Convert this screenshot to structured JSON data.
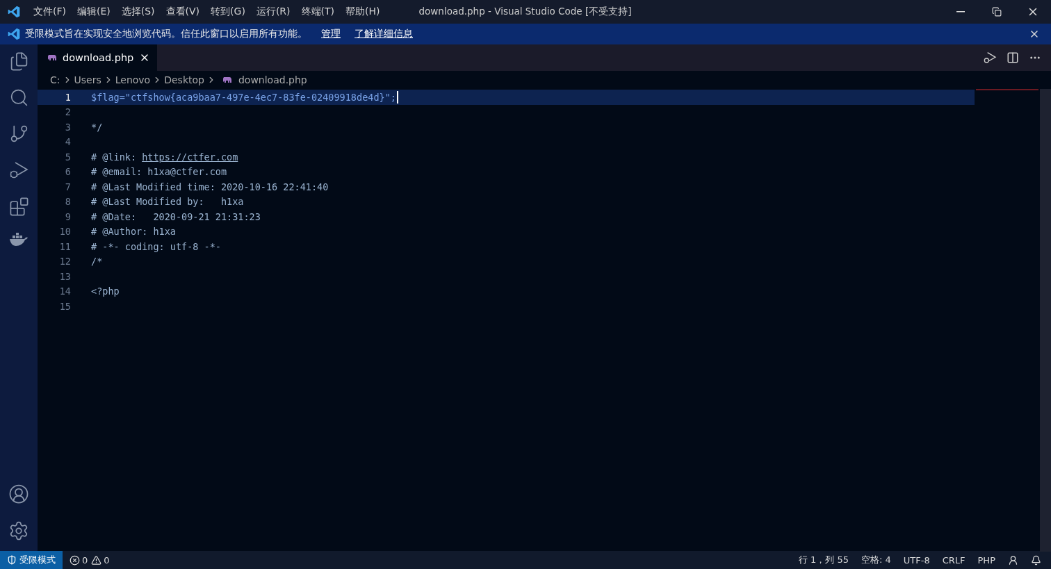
{
  "window": {
    "title": "download.php - Visual Studio Code [不受支持]"
  },
  "menu": [
    "文件(F)",
    "编辑(E)",
    "选择(S)",
    "查看(V)",
    "转到(G)",
    "运行(R)",
    "终端(T)",
    "帮助(H)"
  ],
  "banner": {
    "message": "受限模式旨在实现安全地浏览代码。信任此窗口以启用所有功能。",
    "links": [
      "管理",
      "了解详细信息"
    ]
  },
  "tabs": [
    {
      "label": "download.php",
      "selected": true
    }
  ],
  "breadcrumb": [
    "C:",
    "Users",
    "Lenovo",
    "Desktop",
    "download.php"
  ],
  "code_lines": [
    {
      "number": "1",
      "text": "$flag=\"ctfshow{aca9baa7-497e-4ec7-83fe-02409918de4d}\";",
      "selected": true
    },
    {
      "number": "2",
      "selected": false
    },
    {
      "number": "3",
      "text": "*/",
      "selected": false
    },
    {
      "number": "4",
      "selected": false
    },
    {
      "number": "5",
      "text": "# @link: ",
      "link": "https://ctfer.com",
      "selected": false
    },
    {
      "number": "6",
      "text": "# @email: h1xa@ctfer.com",
      "selected": false
    },
    {
      "number": "7",
      "text": "# @Last Modified time: 2020-10-16 22:41:40",
      "selected": false
    },
    {
      "number": "8",
      "text": "# @Last Modified by:   h1xa",
      "selected": false
    },
    {
      "number": "9",
      "text": "# @Date:   2020-09-21 21:31:23",
      "selected": false
    },
    {
      "number": "10",
      "text": "# @Author: h1xa",
      "selected": false
    },
    {
      "number": "11",
      "text": "# -*- coding: utf-8 -*-",
      "selected": false
    },
    {
      "number": "12",
      "text": "/*",
      "selected": false
    },
    {
      "number": "13",
      "selected": false
    },
    {
      "number": "14",
      "text": "<?php",
      "selected": false
    },
    {
      "number": "15",
      "selected": false
    }
  ],
  "status_bar": {
    "mode": "受限模式",
    "errors": "0",
    "warnings": "0",
    "items": [
      "行 1，列 55",
      "空格: 4",
      "UTF-8",
      "CRLF",
      "PHP"
    ]
  }
}
